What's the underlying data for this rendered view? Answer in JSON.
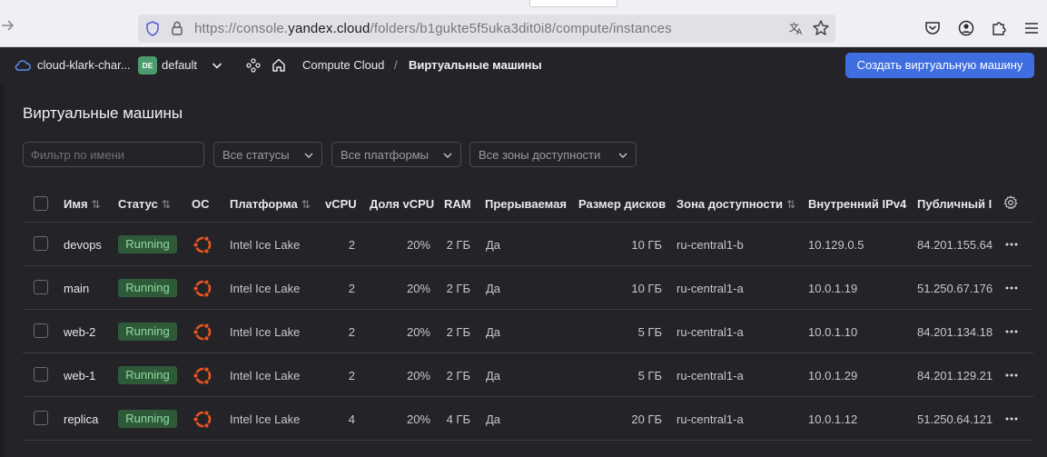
{
  "browser": {
    "url_prefix": "https://console.",
    "url_domain": "yandex.cloud",
    "url_path": "/folders/b1gukte5f5uka3dit0i8/compute/instances"
  },
  "header": {
    "cloud_name": "cloud-klark-char...",
    "folder_badge": "DE",
    "folder_name": "default",
    "breadcrumb_service": "Compute Cloud",
    "breadcrumb_sep": "/",
    "breadcrumb_page": "Виртуальные машины",
    "create_button": "Создать виртуальную машину"
  },
  "page": {
    "title": "Виртуальные машины",
    "filter_placeholder": "Фильтр по имени",
    "status_select": "Все статусы",
    "platform_select": "Все платформы",
    "zone_select": "Все зоны доступности"
  },
  "table": {
    "columns": {
      "name": "Имя",
      "status": "Статус",
      "os": "ОС",
      "platform": "Платформа",
      "vcpu": "vCPU",
      "vcpu_share": "Доля vCPU",
      "ram": "RAM",
      "preemptible": "Прерываемая",
      "disk": "Размер дисков",
      "zone": "Зона доступности",
      "internal_ip": "Внутренний IPv4",
      "public_ip": "Публичный IP"
    },
    "sort_glyph": "⇅",
    "rows": [
      {
        "name": "devops",
        "status": "Running",
        "platform": "Intel Ice Lake",
        "vcpu": "2",
        "share": "20%",
        "ram": "2 ГБ",
        "preemptible": "Да",
        "disk": "10 ГБ",
        "zone": "ru-central1-b",
        "internal_ip": "10.129.0.5",
        "public_ip": "84.201.155.64"
      },
      {
        "name": "main",
        "status": "Running",
        "platform": "Intel Ice Lake",
        "vcpu": "2",
        "share": "20%",
        "ram": "2 ГБ",
        "preemptible": "Да",
        "disk": "10 ГБ",
        "zone": "ru-central1-a",
        "internal_ip": "10.0.1.19",
        "public_ip": "51.250.67.176"
      },
      {
        "name": "web-2",
        "status": "Running",
        "platform": "Intel Ice Lake",
        "vcpu": "2",
        "share": "20%",
        "ram": "2 ГБ",
        "preemptible": "Да",
        "disk": "5 ГБ",
        "zone": "ru-central1-a",
        "internal_ip": "10.0.1.10",
        "public_ip": "84.201.134.18"
      },
      {
        "name": "web-1",
        "status": "Running",
        "platform": "Intel Ice Lake",
        "vcpu": "2",
        "share": "20%",
        "ram": "2 ГБ",
        "preemptible": "Да",
        "disk": "5 ГБ",
        "zone": "ru-central1-a",
        "internal_ip": "10.0.1.29",
        "public_ip": "84.201.129.21"
      },
      {
        "name": "replica",
        "status": "Running",
        "platform": "Intel Ice Lake",
        "vcpu": "4",
        "share": "20%",
        "ram": "4 ГБ",
        "preemptible": "Да",
        "disk": "20 ГБ",
        "zone": "ru-central1-a",
        "internal_ip": "10.0.1.12",
        "public_ip": "51.250.64.121"
      }
    ]
  },
  "colors": {
    "accent": "#3e6ee0",
    "status_running_bg": "#2f5a3a",
    "status_running_text": "#8fdc9e",
    "ubuntu": "#e95420",
    "folder_badge": "#4c9b6c"
  },
  "icons": [
    "back-arrow-icon",
    "shield-icon",
    "lock-icon",
    "translate-icon",
    "star-icon",
    "pocket-icon",
    "account-icon",
    "extensions-icon",
    "menu-icon",
    "cloud-icon",
    "chevron-down-icon",
    "services-hub-icon",
    "home-icon",
    "gear-icon",
    "ubuntu-icon",
    "more-icon"
  ]
}
